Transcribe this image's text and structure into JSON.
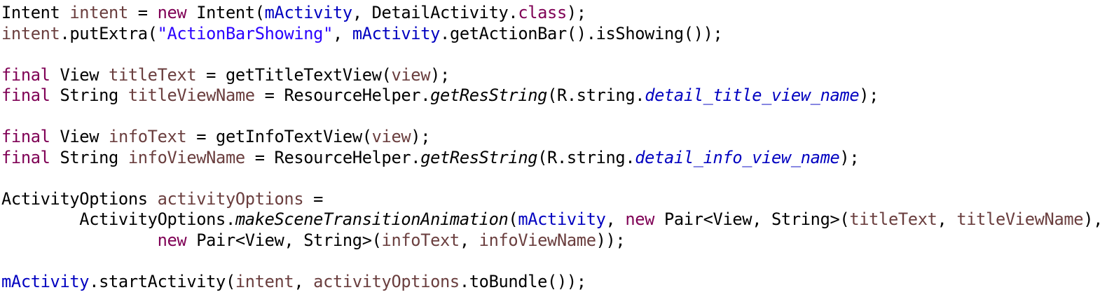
{
  "code_lines": [
    {
      "tokens": [
        {
          "text": "Intent ",
          "type": "plain"
        },
        {
          "text": "intent",
          "type": "local"
        },
        {
          "text": " = ",
          "type": "plain"
        },
        {
          "text": "new",
          "type": "kw"
        },
        {
          "text": " Intent(",
          "type": "plain"
        },
        {
          "text": "mActivity",
          "type": "field"
        },
        {
          "text": ", DetailActivity.",
          "type": "plain"
        },
        {
          "text": "class",
          "type": "kw"
        },
        {
          "text": ");",
          "type": "plain"
        }
      ]
    },
    {
      "tokens": [
        {
          "text": "intent",
          "type": "local"
        },
        {
          "text": ".putExtra(",
          "type": "plain"
        },
        {
          "text": "\"ActionBarShowing\"",
          "type": "str"
        },
        {
          "text": ", ",
          "type": "plain"
        },
        {
          "text": "mActivity",
          "type": "field"
        },
        {
          "text": ".getActionBar().isShowing());",
          "type": "plain"
        }
      ]
    },
    {
      "tokens": []
    },
    {
      "tokens": [
        {
          "text": "final",
          "type": "kw"
        },
        {
          "text": " View ",
          "type": "plain"
        },
        {
          "text": "titleText",
          "type": "local"
        },
        {
          "text": " = getTitleTextView(",
          "type": "plain"
        },
        {
          "text": "view",
          "type": "local"
        },
        {
          "text": ");",
          "type": "plain"
        }
      ]
    },
    {
      "tokens": [
        {
          "text": "final",
          "type": "kw"
        },
        {
          "text": " String ",
          "type": "plain"
        },
        {
          "text": "titleViewName",
          "type": "local"
        },
        {
          "text": " = ResourceHelper.",
          "type": "plain"
        },
        {
          "text": "getResString",
          "type": "italic"
        },
        {
          "text": "(R.string.",
          "type": "plain"
        },
        {
          "text": "detail_title_view_name",
          "type": "static"
        },
        {
          "text": ");",
          "type": "plain"
        }
      ]
    },
    {
      "tokens": []
    },
    {
      "tokens": [
        {
          "text": "final",
          "type": "kw"
        },
        {
          "text": " View ",
          "type": "plain"
        },
        {
          "text": "infoText",
          "type": "local"
        },
        {
          "text": " = getInfoTextView(",
          "type": "plain"
        },
        {
          "text": "view",
          "type": "local"
        },
        {
          "text": ");",
          "type": "plain"
        }
      ]
    },
    {
      "tokens": [
        {
          "text": "final",
          "type": "kw"
        },
        {
          "text": " String ",
          "type": "plain"
        },
        {
          "text": "infoViewName",
          "type": "local"
        },
        {
          "text": " = ResourceHelper.",
          "type": "plain"
        },
        {
          "text": "getResString",
          "type": "italic"
        },
        {
          "text": "(R.string.",
          "type": "plain"
        },
        {
          "text": "detail_info_view_name",
          "type": "static"
        },
        {
          "text": ");",
          "type": "plain"
        }
      ]
    },
    {
      "tokens": []
    },
    {
      "tokens": [
        {
          "text": "ActivityOptions ",
          "type": "plain"
        },
        {
          "text": "activityOptions",
          "type": "local"
        },
        {
          "text": " =",
          "type": "plain"
        }
      ]
    },
    {
      "tokens": [
        {
          "text": "        ActivityOptions.",
          "type": "plain"
        },
        {
          "text": "makeSceneTransitionAnimation",
          "type": "italic"
        },
        {
          "text": "(",
          "type": "plain"
        },
        {
          "text": "mActivity",
          "type": "field"
        },
        {
          "text": ", ",
          "type": "plain"
        },
        {
          "text": "new",
          "type": "kw"
        },
        {
          "text": " Pair<View, String>(",
          "type": "plain"
        },
        {
          "text": "titleText",
          "type": "local"
        },
        {
          "text": ", ",
          "type": "plain"
        },
        {
          "text": "titleViewName",
          "type": "local"
        },
        {
          "text": "),",
          "type": "plain"
        }
      ]
    },
    {
      "tokens": [
        {
          "text": "                ",
          "type": "plain"
        },
        {
          "text": "new",
          "type": "kw"
        },
        {
          "text": " Pair<View, String>(",
          "type": "plain"
        },
        {
          "text": "infoText",
          "type": "local"
        },
        {
          "text": ", ",
          "type": "plain"
        },
        {
          "text": "infoViewName",
          "type": "local"
        },
        {
          "text": "));",
          "type": "plain"
        }
      ]
    },
    {
      "tokens": []
    },
    {
      "tokens": [
        {
          "text": "mActivity",
          "type": "field"
        },
        {
          "text": ".startActivity(",
          "type": "plain"
        },
        {
          "text": "intent",
          "type": "local"
        },
        {
          "text": ", ",
          "type": "plain"
        },
        {
          "text": "activityOptions",
          "type": "local"
        },
        {
          "text": ".toBundle());",
          "type": "plain"
        }
      ]
    }
  ],
  "colors": {
    "keyword": "#7f0055",
    "local_variable": "#6a3e3e",
    "field": "#0000c0",
    "string": "#2a00ff",
    "background": "#ffffff",
    "text": "#000000"
  }
}
